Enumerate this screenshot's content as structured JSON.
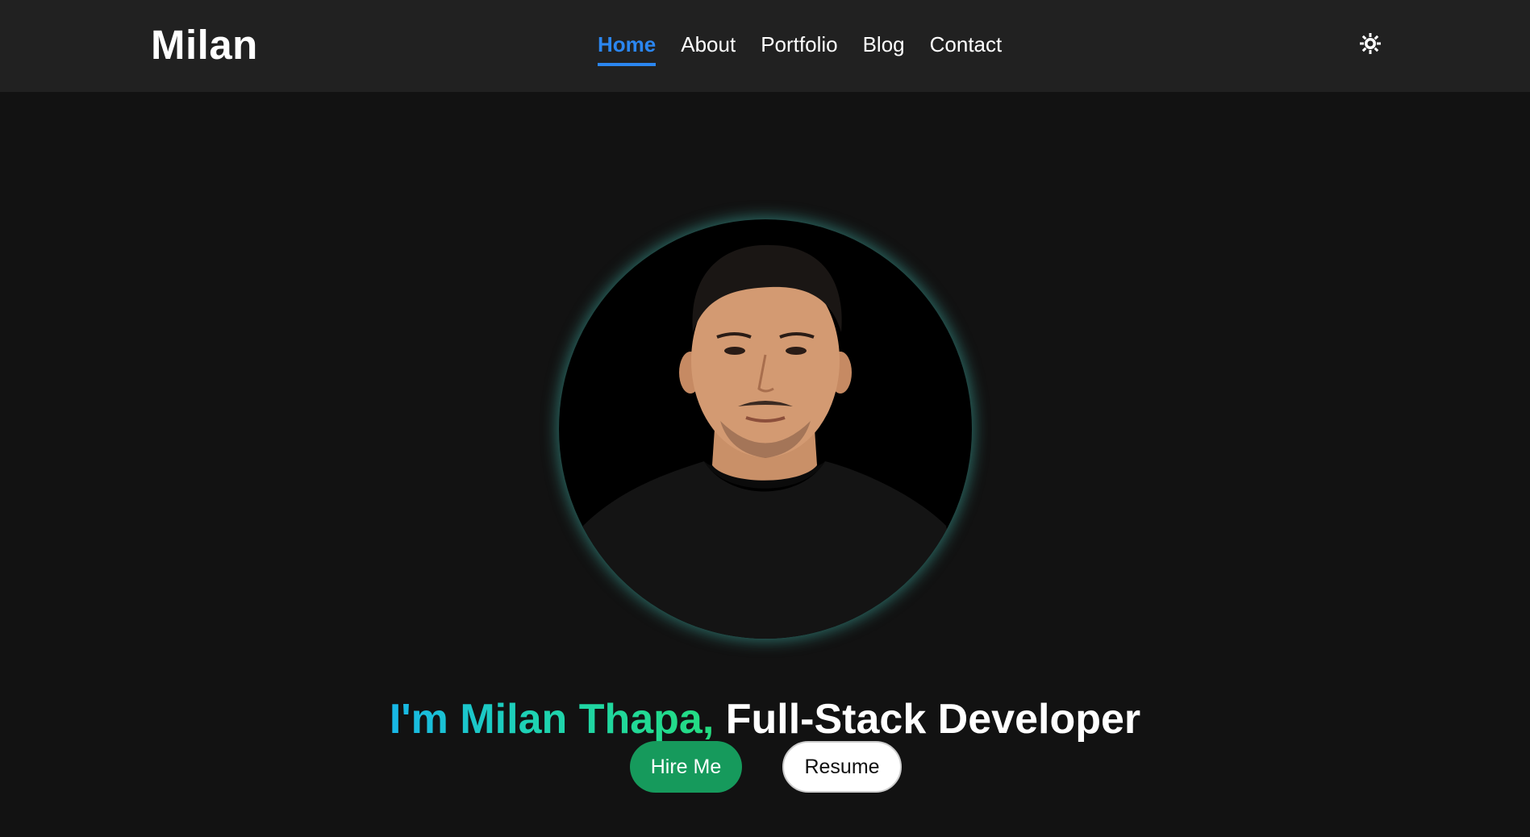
{
  "header": {
    "logo": "Milan",
    "nav": [
      {
        "label": "Home",
        "active": true
      },
      {
        "label": "About",
        "active": false
      },
      {
        "label": "Portfolio",
        "active": false
      },
      {
        "label": "Blog",
        "active": false
      },
      {
        "label": "Contact",
        "active": false
      }
    ],
    "theme_toggle_icon": "sun-icon"
  },
  "hero": {
    "profile_photo": "profile-photo",
    "headline_intro": "I'm Milan Thapa,",
    "headline_role": "Full-Stack Developer",
    "hire_button": "Hire Me",
    "resume_button": "Resume"
  },
  "colors": {
    "nav_bg": "#212121",
    "page_bg": "#121212",
    "active_link": "#2b86f0",
    "hire_button_bg": "#169a5c",
    "gradient_start": "#18b7e8",
    "gradient_end": "#24dd80"
  }
}
